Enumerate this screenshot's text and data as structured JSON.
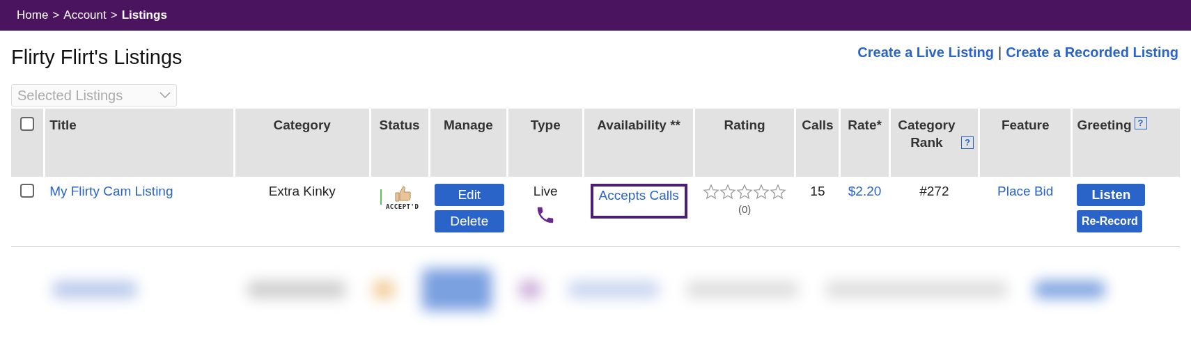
{
  "breadcrumb": [
    {
      "label": "Home",
      "current": false
    },
    {
      "label": "Account",
      "current": false
    },
    {
      "label": "Listings",
      "current": true
    }
  ],
  "breadcrumb_separator": ">",
  "page_title": "Flirty Flirt's Listings",
  "create_links": [
    "Create a Live Listing",
    "Create a Recorded Listing"
  ],
  "create_links_separator": "|",
  "bulk_select": {
    "placeholder": "Selected Listings"
  },
  "table": {
    "select_all": {
      "checked": false
    },
    "columns": [
      {
        "label": "Title"
      },
      {
        "label": "Category"
      },
      {
        "label": "Status"
      },
      {
        "label": "Manage"
      },
      {
        "label": "Type"
      },
      {
        "label": "Availability **"
      },
      {
        "label": "Rating"
      },
      {
        "label": "Calls"
      },
      {
        "label": "Rate*"
      },
      {
        "label": "Category Rank",
        "help": "?"
      },
      {
        "label": "Feature"
      },
      {
        "label": "Greeting",
        "help": "?"
      }
    ],
    "rows": [
      {
        "checked": false,
        "title": "My Flirty Cam Listing",
        "category": "Extra Kinky",
        "status": "ACCEPT'D",
        "manage": [
          "Edit",
          "Delete"
        ],
        "type": "Live",
        "availability": "Accepts Calls",
        "availability_highlighted": true,
        "stars": 0,
        "rating_count": "(0)",
        "calls": "15",
        "rate": "$2.20",
        "category_rank": "#272",
        "feature": "Place Bid",
        "greeting": [
          "Listen",
          "Re-Record"
        ]
      }
    ]
  }
}
